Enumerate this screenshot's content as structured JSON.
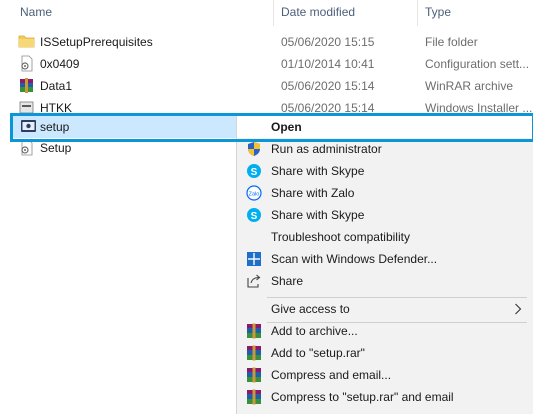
{
  "columns": {
    "name": "Name",
    "date_modified": "Date modified",
    "type": "Type"
  },
  "files": [
    {
      "name": "ISSetupPrerequisites",
      "date": "05/06/2020 15:15",
      "type": "File folder",
      "icon": "folder-icon"
    },
    {
      "name": "0x0409",
      "date": "01/10/2014 10:41",
      "type": "Configuration sett...",
      "icon": "config-file-icon"
    },
    {
      "name": "Data1",
      "date": "05/06/2020 15:14",
      "type": "WinRAR archive",
      "icon": "winrar-archive-icon"
    },
    {
      "name": "HTKK",
      "date": "05/06/2020 15:14",
      "type": "Windows Installer ...",
      "icon": "installer-icon"
    },
    {
      "name": "setup",
      "date": "",
      "type": "",
      "icon": "setup-exe-icon"
    },
    {
      "name": "Setup",
      "date": "",
      "type": "",
      "icon": "config-file-icon"
    }
  ],
  "context_menu": {
    "open": "Open",
    "run_as_admin": "Run as administrator",
    "share_skype_1": "Share with Skype",
    "share_zalo": "Share with Zalo",
    "share_skype_2": "Share with Skype",
    "troubleshoot": "Troubleshoot compatibility",
    "scan_defender": "Scan with Windows Defender...",
    "share": "Share",
    "give_access": "Give access to",
    "add_archive": "Add to archive...",
    "add_setup_rar": "Add to \"setup.rar\"",
    "compress_email": "Compress and email...",
    "compress_setup_email": "Compress to \"setup.rar\" and email"
  },
  "colors": {
    "highlight": "#0a96d7",
    "selection": "#cce8ff",
    "menu_bg": "#f2f2f2",
    "folder": "#f4c95d",
    "skype": "#00aff0"
  }
}
